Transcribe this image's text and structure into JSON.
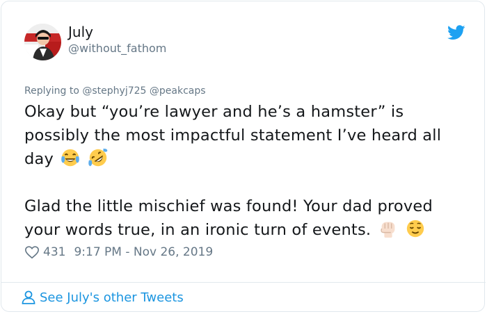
{
  "author": {
    "name": "July",
    "handle": "@without_fathom"
  },
  "reply": {
    "prefix": "Replying to",
    "mentions": [
      "@stephyj725",
      "@peakcaps"
    ]
  },
  "tweet": {
    "line1": "Okay but “you’re lawyer and he’s a hamster” is possibly the most impactful statement I’ve heard all day",
    "line2": "Glad the little mischief was found! Your dad proved your words true, in an ironic turn of events.",
    "emoji1": [
      "face-with-tears-of-joy-emoji",
      "rolling-on-the-floor-laughing-emoji"
    ],
    "emoji2": [
      "raised-fist-light-skin-emoji",
      "relieved-face-emoji"
    ]
  },
  "stats": {
    "likes": "431",
    "timestamp": "9:17 PM - Nov 26, 2019"
  },
  "footer": {
    "link_label": "See July's other Tweets"
  },
  "colors": {
    "twitter_blue": "#1da1f2",
    "link_blue": "#1b95e0",
    "muted": "#657786",
    "text": "#14171a",
    "border": "#e1e8ed"
  }
}
